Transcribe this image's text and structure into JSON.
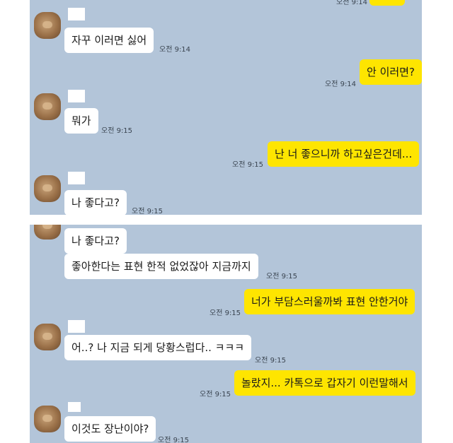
{
  "panel1": {
    "messages": [
      {
        "text": "",
        "time": "오전 9:14"
      },
      {
        "text": "자꾸 이러면 싫어",
        "time": "오전 9:14"
      },
      {
        "text": "안 이러면?",
        "time": "오전 9:14"
      },
      {
        "text": "뭐가",
        "time": "오전 9:15"
      },
      {
        "text": "난 너 좋으니까 하고싶은건데...",
        "time": "오전 9:15"
      },
      {
        "text": "나 좋다고?",
        "time": "오전 9:15"
      }
    ]
  },
  "panel2": {
    "messages": [
      {
        "text": "나 좋다고?"
      },
      {
        "text": "좋아한다는 표현 한적 없었잖아 지금까지",
        "time": "오전 9:15"
      },
      {
        "text": "너가 부담스러울까봐 표현 안한거야",
        "time": "오전 9:15"
      },
      {
        "text": "어..? 나 지금 되게 당황스럽다.. ㅋㅋㅋ",
        "time": "오전 9:15"
      },
      {
        "text": "놀랐지... 카톡으로 갑자기 이런말해서",
        "time": "오전 9:15"
      },
      {
        "text": "이것도 장난이야?",
        "time": "오전 9:15"
      }
    ]
  }
}
